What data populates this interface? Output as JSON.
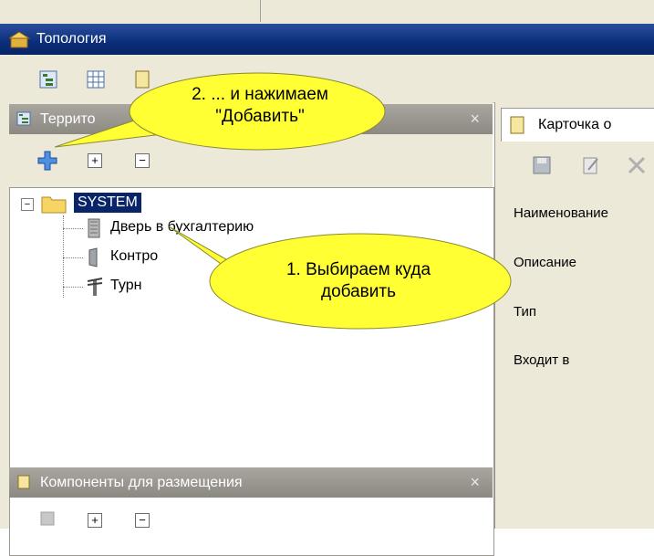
{
  "window": {
    "title": "Топология"
  },
  "toolbar": {
    "icons": [
      "tree-view-icon",
      "grid-icon",
      "card-icon"
    ]
  },
  "territory_pane": {
    "title": "Террито",
    "close": "×",
    "actions": {
      "add_icon": "plus-icon",
      "expand": "+",
      "collapse": "−"
    },
    "tree": {
      "root": {
        "toggle": "⊟",
        "label": "SYSTEM"
      },
      "children": [
        {
          "label": "Дверь в бухгалтерию",
          "icon": "door-icon"
        },
        {
          "label": "Контро",
          "icon": "controller-icon"
        },
        {
          "label": "Турн",
          "icon": "turnstile-icon"
        }
      ]
    }
  },
  "components_pane": {
    "title": "Компоненты для размещения",
    "close": "×",
    "actions": {
      "expand": "+",
      "collapse": "−"
    }
  },
  "card_pane": {
    "tab_title": "Карточка о",
    "fields": [
      "Наименование",
      "Описание",
      "Тип",
      "Входит в"
    ]
  },
  "callouts": {
    "add": {
      "line1": "2. ... и нажимаем",
      "line2": "\"Добавить\""
    },
    "select": {
      "line1": "1. Выбираем куда",
      "line2": "добавить"
    }
  },
  "colors": {
    "titlebar": "#0b2e7a",
    "callout_fill": "#ffff33",
    "selection": "#0a246a"
  }
}
